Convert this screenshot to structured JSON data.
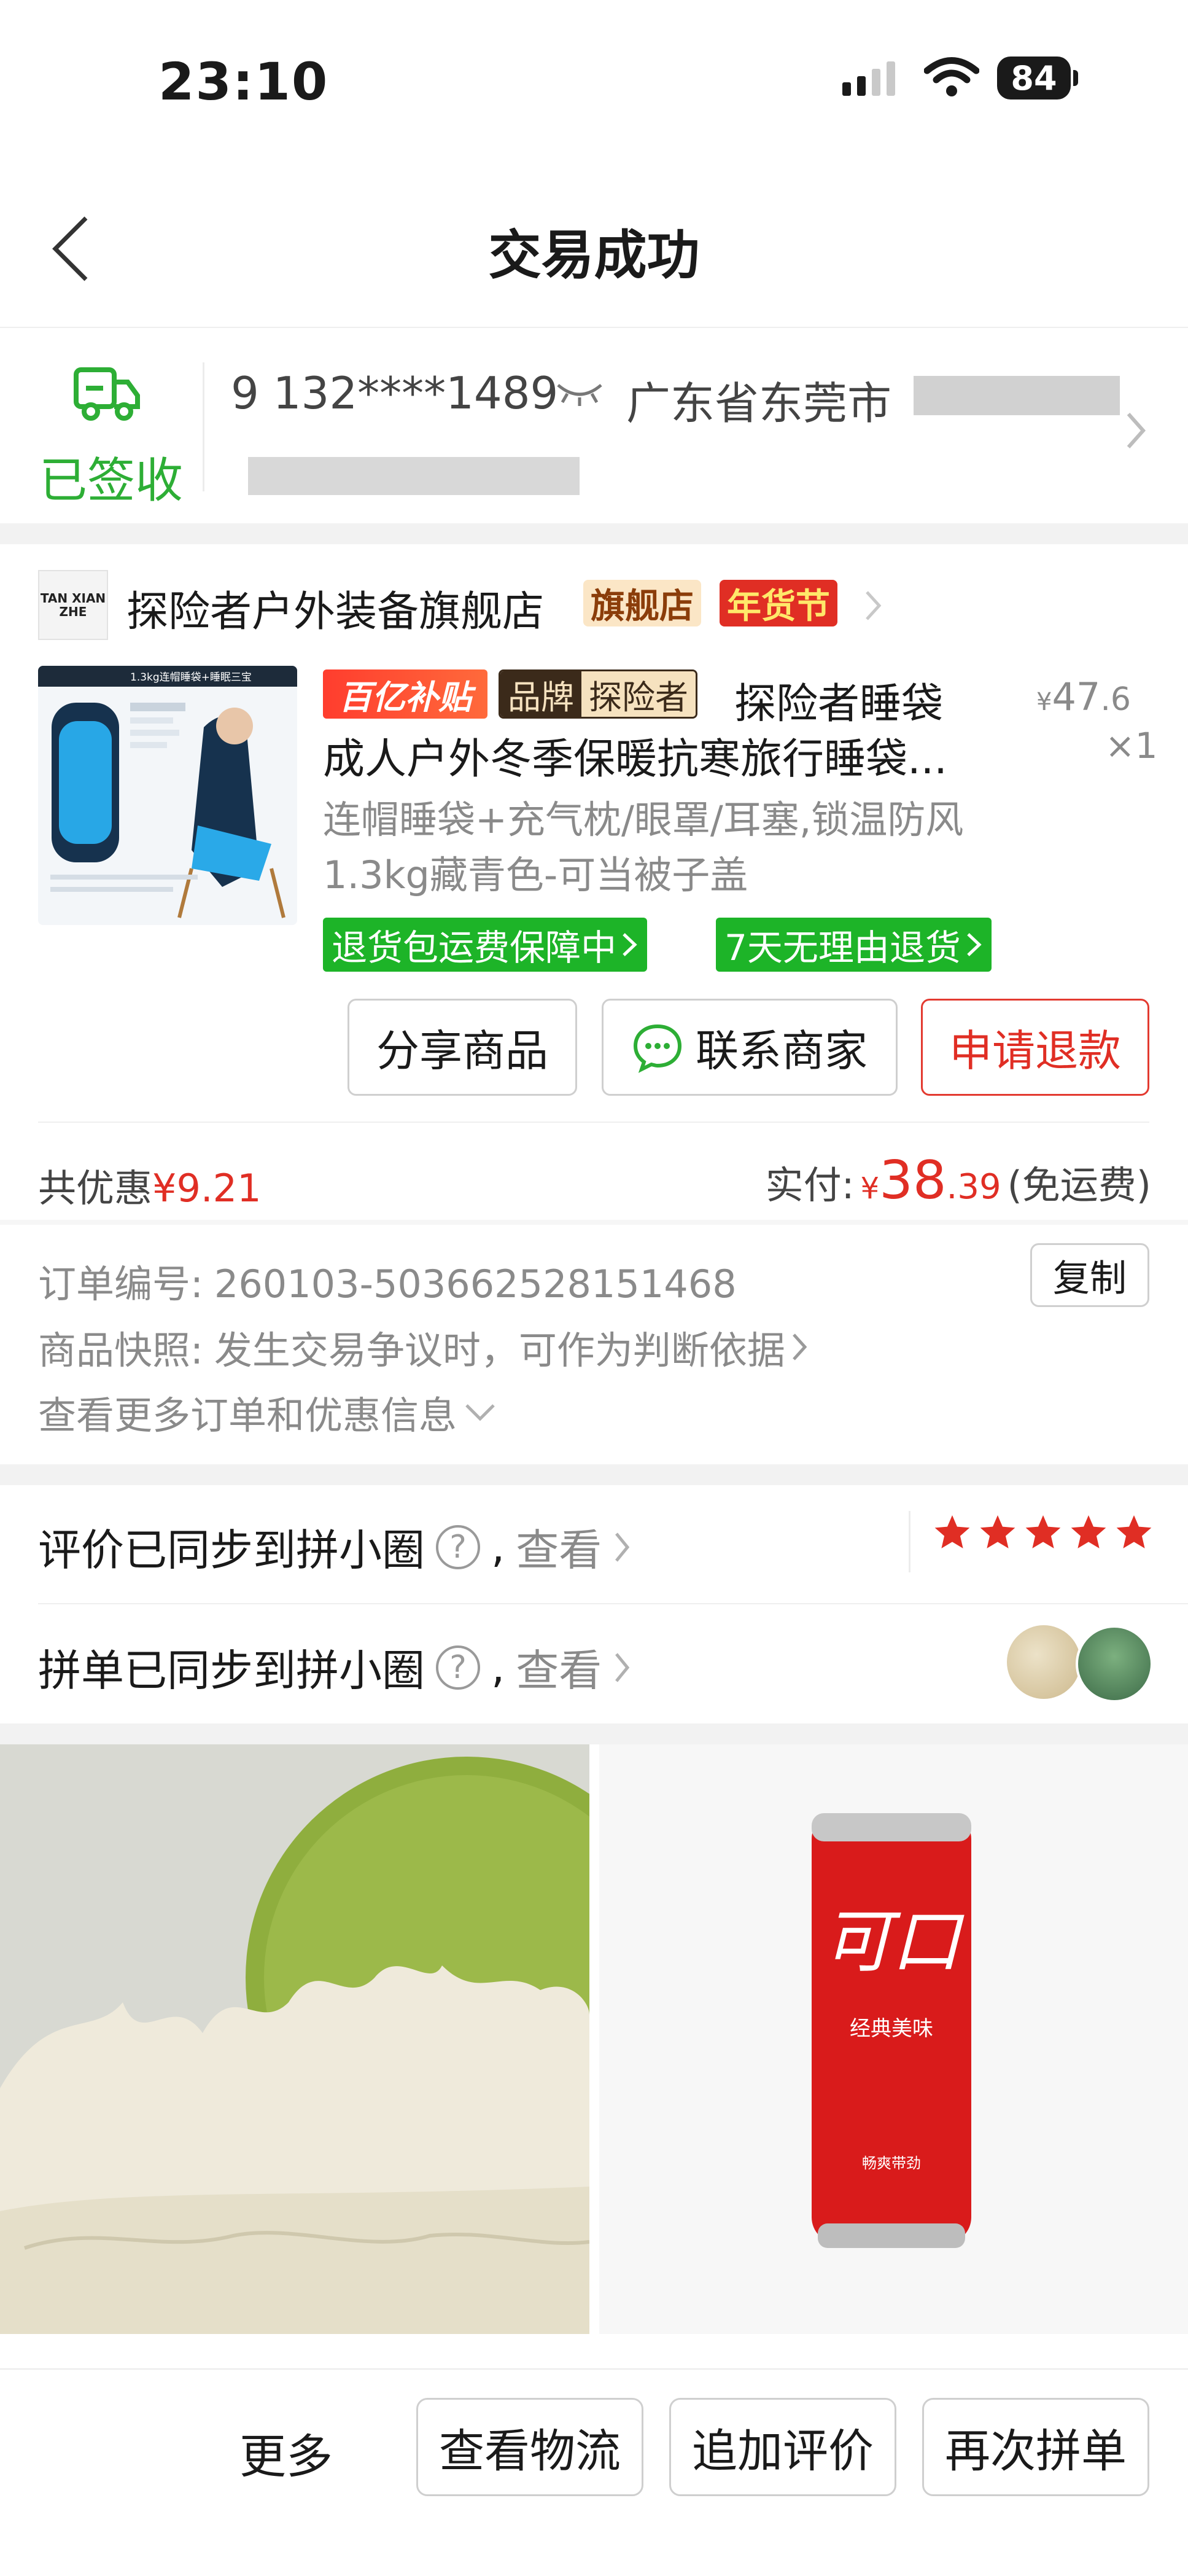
{
  "status_bar": {
    "time": "23:10",
    "battery": "84"
  },
  "nav": {
    "title": "交易成功"
  },
  "delivery": {
    "status": "已签收",
    "phone": "9 132****1489",
    "address_prefix": "广东省东莞市"
  },
  "store": {
    "name": "探险者户外装备旗舰店",
    "logo_text": "TAN XIAN ZHE",
    "tag_flagship": "旗舰店",
    "tag_festival": "年货节"
  },
  "product": {
    "promo_badge": "百亿补贴",
    "brand_badge_1": "品牌",
    "brand_badge_2": "探险者",
    "title_1": "探险者睡袋",
    "title_2": "成人户外冬季保暖抗寒旅行睡袋...",
    "price_symbol": "¥",
    "price_int": "47",
    "price_dec": ".6",
    "quantity": "×1",
    "sku": "连帽睡袋+充气枕/眼罩/耳塞,锁温防风1.3kg藏青色-可当被子盖",
    "service_tags": [
      "退货包运费保障中",
      "7天无理由退货"
    ],
    "image_caption": "1.3kg连帽睡袋+睡眠三宝"
  },
  "actions": {
    "share": "分享商品",
    "contact": "联系商家",
    "refund": "申请退款"
  },
  "payment": {
    "discount_label": "共优惠",
    "discount_value": "¥9.21",
    "paid_label": "实付:",
    "currency": "¥",
    "paid_int": "38",
    "paid_dec": ".39",
    "shipping": "(免运费)"
  },
  "order": {
    "number_label": "订单编号:",
    "number": "260103-503662528151468",
    "copy": "复制",
    "snapshot_label": "商品快照:",
    "snapshot_text": "发生交易争议时，可作为判断依据",
    "more": "查看更多订单和优惠信息"
  },
  "sync": {
    "review_text": "评价已同步到拼小圈",
    "group_text": "拼单已同步到拼小圈",
    "comma": ",",
    "view": "查看",
    "rating": 5
  },
  "feed": {
    "right_brand_text": "可口",
    "right_can_text_1": "经典美味",
    "right_can_text_2": "畅爽带劲"
  },
  "bottom_bar": {
    "more": "更多",
    "logistics": "查看物流",
    "add_review": "追加评价",
    "reorder": "再次拼单"
  },
  "colors": {
    "accent_red": "#e02e24",
    "success_green": "#2dae35",
    "service_green": "#1db428"
  }
}
